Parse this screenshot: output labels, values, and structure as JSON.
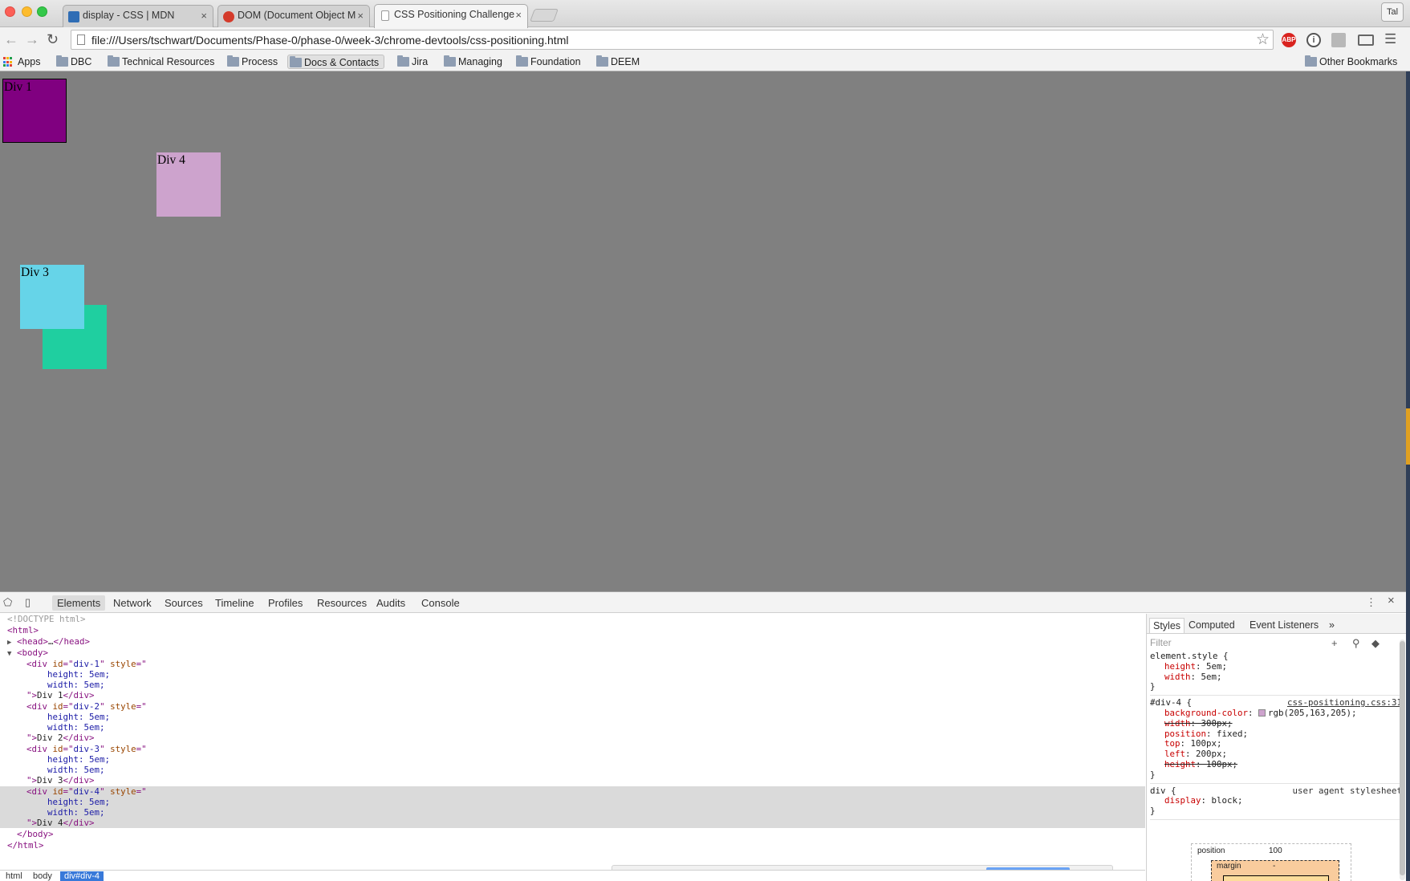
{
  "browser": {
    "tabs": [
      {
        "title": "display - CSS | MDN",
        "icon_color": "#2f6db5"
      },
      {
        "title": "DOM (Document Object M",
        "icon_color": "#d43b2b"
      },
      {
        "title": "CSS Positioning Challenge",
        "icon_color": "#ffffff"
      }
    ],
    "profile_name": "Tal",
    "url": "file:///Users/tschwart/Documents/Phase-0/phase-0/week-3/chrome-devtools/css-positioning.html",
    "extension_abp": "ABP",
    "bookmarks": [
      {
        "label": "Apps"
      },
      {
        "label": "DBC"
      },
      {
        "label": "Technical Resources"
      },
      {
        "label": "Process"
      },
      {
        "label": "Docs & Contacts"
      },
      {
        "label": "Jira"
      },
      {
        "label": "Managing"
      },
      {
        "label": "Foundation"
      },
      {
        "label": "DEEM"
      }
    ],
    "other_bookmarks": "Other Bookmarks"
  },
  "page": {
    "div1": {
      "label": "Div 1",
      "color": "#800080"
    },
    "div2": {
      "label": "",
      "color": "#1fcfa0"
    },
    "div3": {
      "label": "Div 3",
      "color": "#66d4e8"
    },
    "div4": {
      "label": "Div 4",
      "color": "#cda3cd"
    }
  },
  "devtools": {
    "tabs": [
      "Elements",
      "Network",
      "Sources",
      "Timeline",
      "Profiles",
      "Resources",
      "Audits",
      "Console"
    ],
    "dom": {
      "doctype": "<!DOCTYPE html>",
      "html_open": "html",
      "head": "head",
      "head_ellipsis": "…",
      "body_open": "body",
      "divs": [
        {
          "id": "div-1",
          "text": "Div 1"
        },
        {
          "id": "div-2",
          "text": "Div 2"
        },
        {
          "id": "div-3",
          "text": "Div 3"
        },
        {
          "id": "div-4",
          "text": "Div 4"
        }
      ],
      "style_height": "height: 5em;",
      "style_width": "width: 5em;"
    },
    "breadcrumb": [
      "html",
      "body",
      "div#div-4"
    ],
    "sidebar": {
      "tabs": [
        "Styles",
        "Computed",
        "Event Listeners"
      ],
      "more": "»",
      "filter_placeholder": "Filter",
      "element_style": {
        "selector": "element.style {",
        "decls": [
          {
            "prop": "height",
            "value": "5em;"
          },
          {
            "prop": "width",
            "value": "5em;"
          }
        ],
        "close": "}"
      },
      "div4_rule": {
        "selector": "#div-4 {",
        "source": "css-positioning.css:31",
        "bg_prop": "background-color",
        "bg_value": "rgb(205,163,205);",
        "bg_swatch": "#cda3cd",
        "decls": [
          {
            "prop": "width",
            "value": "300px;",
            "struck": true
          },
          {
            "prop": "position",
            "value": "fixed;",
            "struck": false
          },
          {
            "prop": "top",
            "value": "100px;",
            "struck": false
          },
          {
            "prop": "left",
            "value": "200px;",
            "struck": false
          },
          {
            "prop": "height",
            "value": "100px;",
            "struck": true
          }
        ],
        "close": "}"
      },
      "div_rule": {
        "selector": "div {",
        "source": "user agent stylesheet",
        "decls": [
          {
            "prop": "display",
            "value": "block;"
          }
        ],
        "close": "}"
      },
      "box_model": {
        "position_label": "position",
        "position_value": "100",
        "margin_label": "margin",
        "margin_value": "-"
      }
    }
  }
}
